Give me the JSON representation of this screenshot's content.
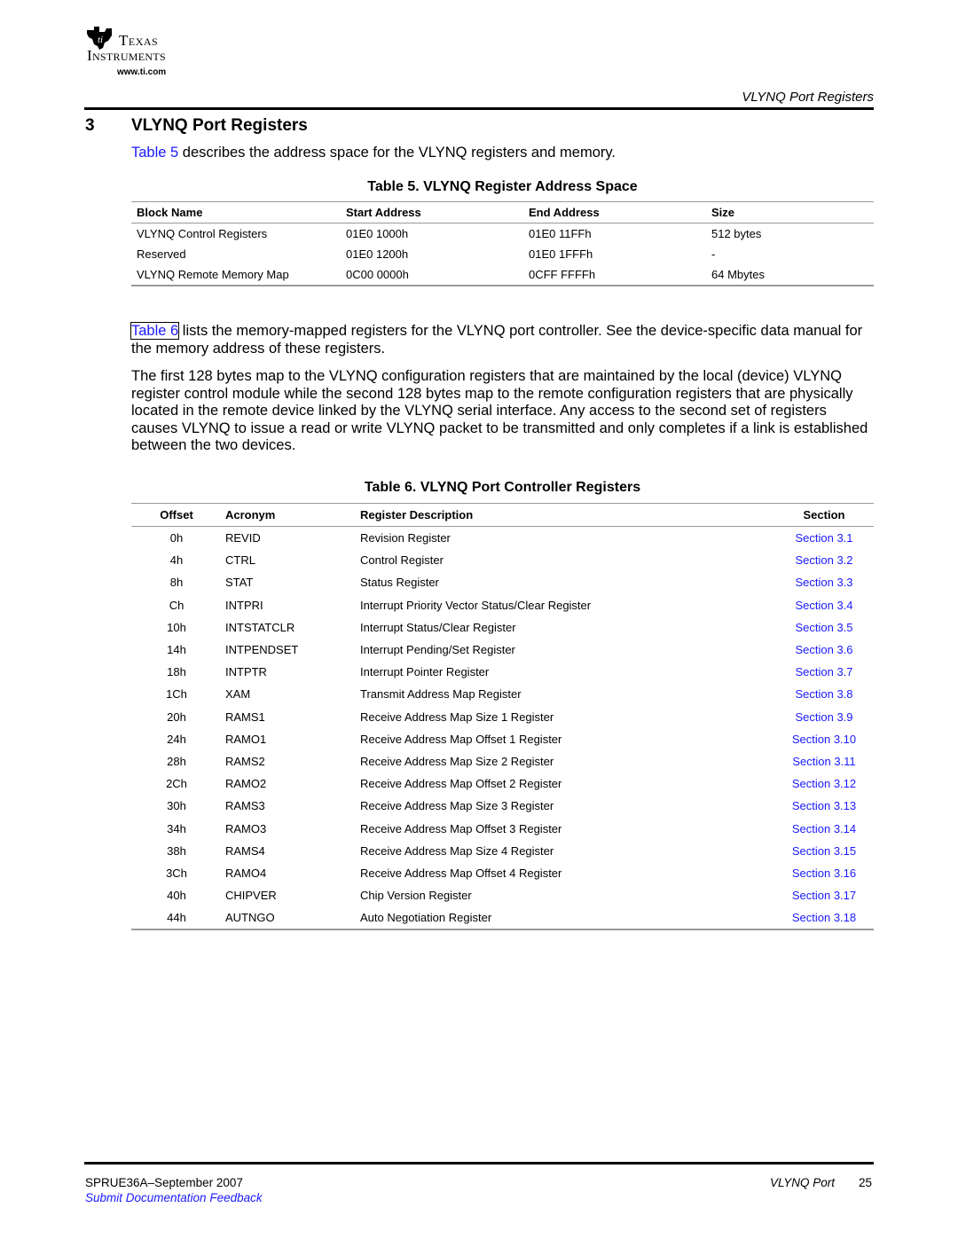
{
  "header": {
    "logo": {
      "icon": "ti-state-icon",
      "line1": "Texas",
      "line2": "Instruments",
      "url": "www.ti.com"
    },
    "running_title": "VLYNQ Port Registers"
  },
  "section": {
    "number": "3",
    "title": "VLYNQ Port Registers"
  },
  "paragraphs": {
    "p1_link": "Table 5",
    "p1_text": " describes the address space for the VLYNQ registers and memory.",
    "p2_link": "Table 6",
    "p2_text": " lists the memory-mapped registers for the VLYNQ port controller. See the device-specific data manual for the memory address of these registers.",
    "p3_text": "The first 128 bytes map to the VLYNQ configuration registers that are maintained by the local (device) VLYNQ register control module while the second 128 bytes map to the remote configuration registers that are physically located in the remote device linked by the VLYNQ serial interface. Any access to the second set of registers causes VLYNQ to issue a read or write VLYNQ packet to be transmitted and only completes if a link is established between the two devices."
  },
  "table5": {
    "caption": "Table 5. VLYNQ Register Address Space",
    "headers": [
      "Block Name",
      "Start Address",
      "End Address",
      "Size"
    ],
    "rows": [
      [
        "VLYNQ Control Registers",
        "01E0 1000h",
        "01E0 11FFh",
        "512 bytes"
      ],
      [
        "Reserved",
        "01E0 1200h",
        "01E0 1FFFh",
        "-"
      ],
      [
        "VLYNQ Remote Memory Map",
        "0C00 0000h",
        "0CFF FFFFh",
        "64 Mbytes"
      ]
    ]
  },
  "table6": {
    "caption": "Table 6. VLYNQ Port Controller Registers",
    "headers": [
      "Offset",
      "Acronym",
      "Register Description",
      "Section"
    ],
    "rows": [
      [
        "0h",
        "REVID",
        "Revision Register",
        "Section 3.1"
      ],
      [
        "4h",
        "CTRL",
        "Control Register",
        "Section 3.2"
      ],
      [
        "8h",
        "STAT",
        "Status Register",
        "Section 3.3"
      ],
      [
        "Ch",
        "INTPRI",
        "Interrupt Priority Vector Status/Clear Register",
        "Section 3.4"
      ],
      [
        "10h",
        "INTSTATCLR",
        "Interrupt Status/Clear Register",
        "Section 3.5"
      ],
      [
        "14h",
        "INTPENDSET",
        "Interrupt Pending/Set Register",
        "Section 3.6"
      ],
      [
        "18h",
        "INTPTR",
        "Interrupt Pointer Register",
        "Section 3.7"
      ],
      [
        "1Ch",
        "XAM",
        "Transmit Address Map Register",
        "Section 3.8"
      ],
      [
        "20h",
        "RAMS1",
        "Receive Address Map Size 1 Register",
        "Section 3.9"
      ],
      [
        "24h",
        "RAMO1",
        "Receive Address Map Offset 1 Register",
        "Section 3.10"
      ],
      [
        "28h",
        "RAMS2",
        "Receive Address Map Size 2 Register",
        "Section 3.11"
      ],
      [
        "2Ch",
        "RAMO2",
        "Receive Address Map Offset 2 Register",
        "Section 3.12"
      ],
      [
        "30h",
        "RAMS3",
        "Receive Address Map Size 3 Register",
        "Section 3.13"
      ],
      [
        "34h",
        "RAMO3",
        "Receive Address Map Offset 3 Register",
        "Section 3.14"
      ],
      [
        "38h",
        "RAMS4",
        "Receive Address Map Size 4 Register",
        "Section 3.15"
      ],
      [
        "3Ch",
        "RAMO4",
        "Receive Address Map Offset 4 Register",
        "Section 3.16"
      ],
      [
        "40h",
        "CHIPVER",
        "Chip Version Register",
        "Section 3.17"
      ],
      [
        "44h",
        "AUTNGO",
        "Auto Negotiation Register",
        "Section 3.18"
      ]
    ]
  },
  "footer": {
    "doc_id": "SPRUE36A–September 2007",
    "feedback_link": "Submit Documentation Feedback",
    "chapter": "VLYNQ Port",
    "page": "25"
  },
  "colors": {
    "link": "#1a1aff",
    "rule": "#000000",
    "table_rule": "#999999"
  }
}
